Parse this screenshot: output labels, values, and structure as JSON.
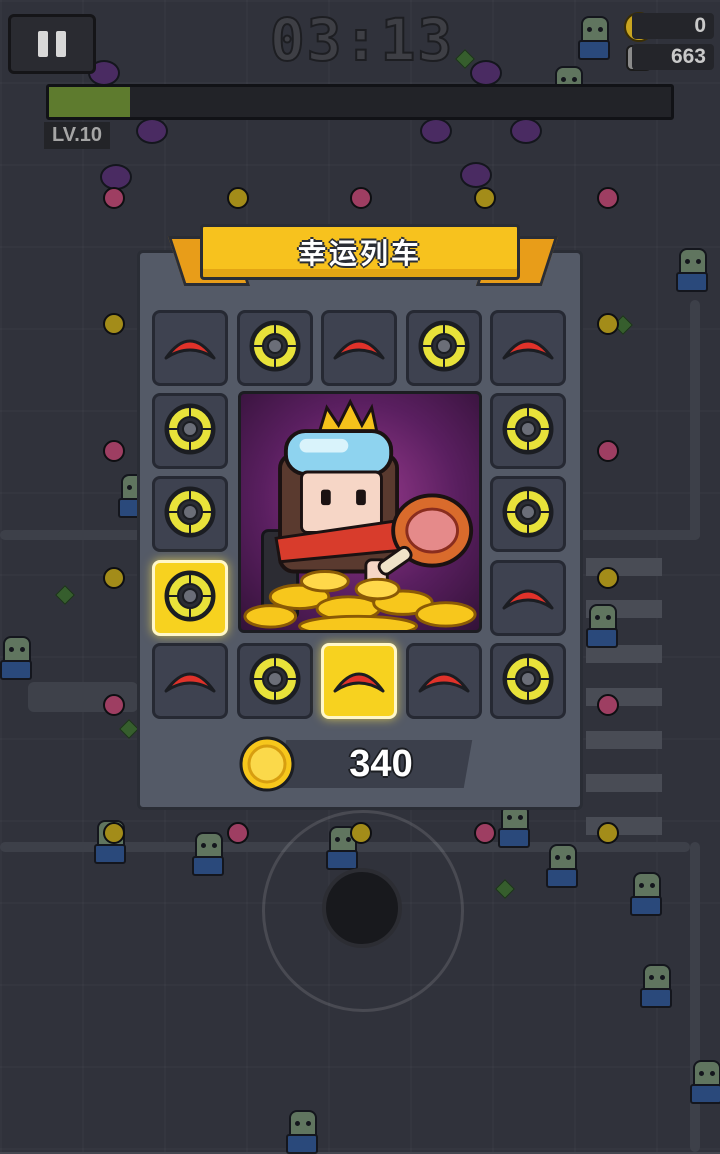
{
  "hud": {
    "timer": "03:13",
    "coins": "0",
    "kills": "663",
    "level": "LV.10",
    "xp_fraction": 0.13
  },
  "event": {
    "title": "幸运列车",
    "reward_amount": "340",
    "slots": [
      {
        "item": "boomerang-icon",
        "active": false
      },
      {
        "item": "shuriken-icon",
        "active": false
      },
      {
        "item": "boomerang-icon",
        "active": false
      },
      {
        "item": "shuriken-icon",
        "active": false
      },
      {
        "item": "boomerang-icon",
        "active": false
      },
      {
        "item": "shuriken-icon",
        "active": false
      },
      {
        "item": "shuriken-icon",
        "active": false
      },
      {
        "item": "shuriken-icon",
        "active": false
      },
      {
        "item": "shuriken-icon",
        "active": false
      },
      {
        "item": "shuriken-icon",
        "active": true
      },
      {
        "item": "boomerang-icon",
        "active": false
      },
      {
        "item": "boomerang-icon",
        "active": false
      },
      {
        "item": "shuriken-icon",
        "active": false
      },
      {
        "item": "boomerang-icon",
        "active": true
      },
      {
        "item": "boomerang-icon",
        "active": false
      },
      {
        "item": "shuriken-icon",
        "active": false
      }
    ]
  },
  "colors": {
    "ribbon": "#f7c21e",
    "panel": "#545a67",
    "active_slot": "#f7d21f",
    "boomerang": "#e0322a",
    "shuriken": "#e8e23a"
  }
}
